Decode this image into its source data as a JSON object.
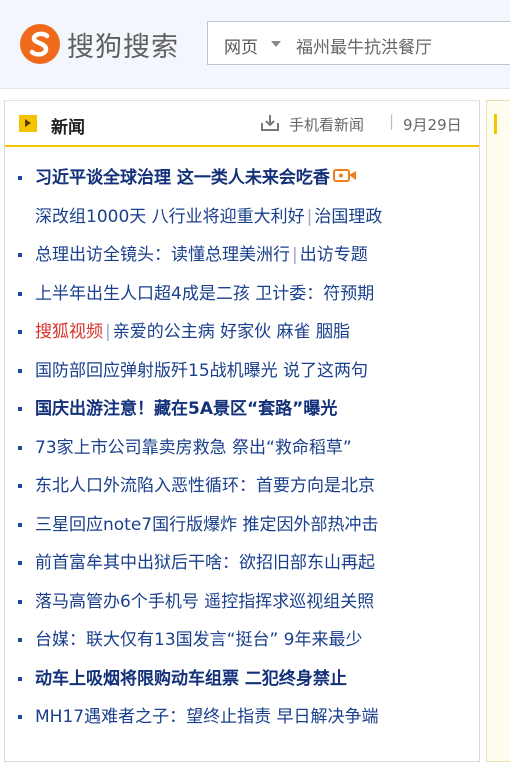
{
  "header": {
    "logo_text": "搜狗搜索",
    "search_scope": "网页",
    "search_query": "福州最牛抗洪餐厅"
  },
  "news": {
    "title": "新闻",
    "mobile_link": "手机看新闻",
    "separator": "|",
    "date": "9月29日",
    "items": [
      {
        "text": "习近平谈全球治理 这一类人未来会吃香"
      },
      {
        "part1": "深改组1000天 八行业将迎重大利好",
        "part2": "治国理政"
      },
      {
        "part1": "总理出访全镜头：读懂总理美洲行",
        "part2": "出访专题"
      },
      {
        "text": "上半年出生人口超4成是二孩 卫计委：符预期"
      },
      {
        "part1": "搜狐视频",
        "part2": "亲爱的公主病 好家伙 麻雀 胭脂"
      },
      {
        "text": "国防部回应弹射版歼15战机曝光 说了这两句"
      },
      {
        "text": "国庆出游注意！藏在5A景区“套路”曝光"
      },
      {
        "text": "73家上市公司靠卖房救急 祭出“救命稻草”"
      },
      {
        "text": "东北人口外流陷入恶性循环：首要方向是北京"
      },
      {
        "text": "三星回应note7国行版爆炸 推定因外部热冲击"
      },
      {
        "text": "前首富牟其中出狱后干啥：欲招旧部东山再起"
      },
      {
        "text": "落马高管办6个手机号 遥控指挥求巡视组关照"
      },
      {
        "text": "台媒：联大仅有13国发言“挺台” 9年来最少"
      },
      {
        "text": "动车上吸烟将限购动车组票 二犯终身禁止"
      },
      {
        "text": "MH17遇难者之子：望终止指责 早日解决争端"
      }
    ]
  }
}
